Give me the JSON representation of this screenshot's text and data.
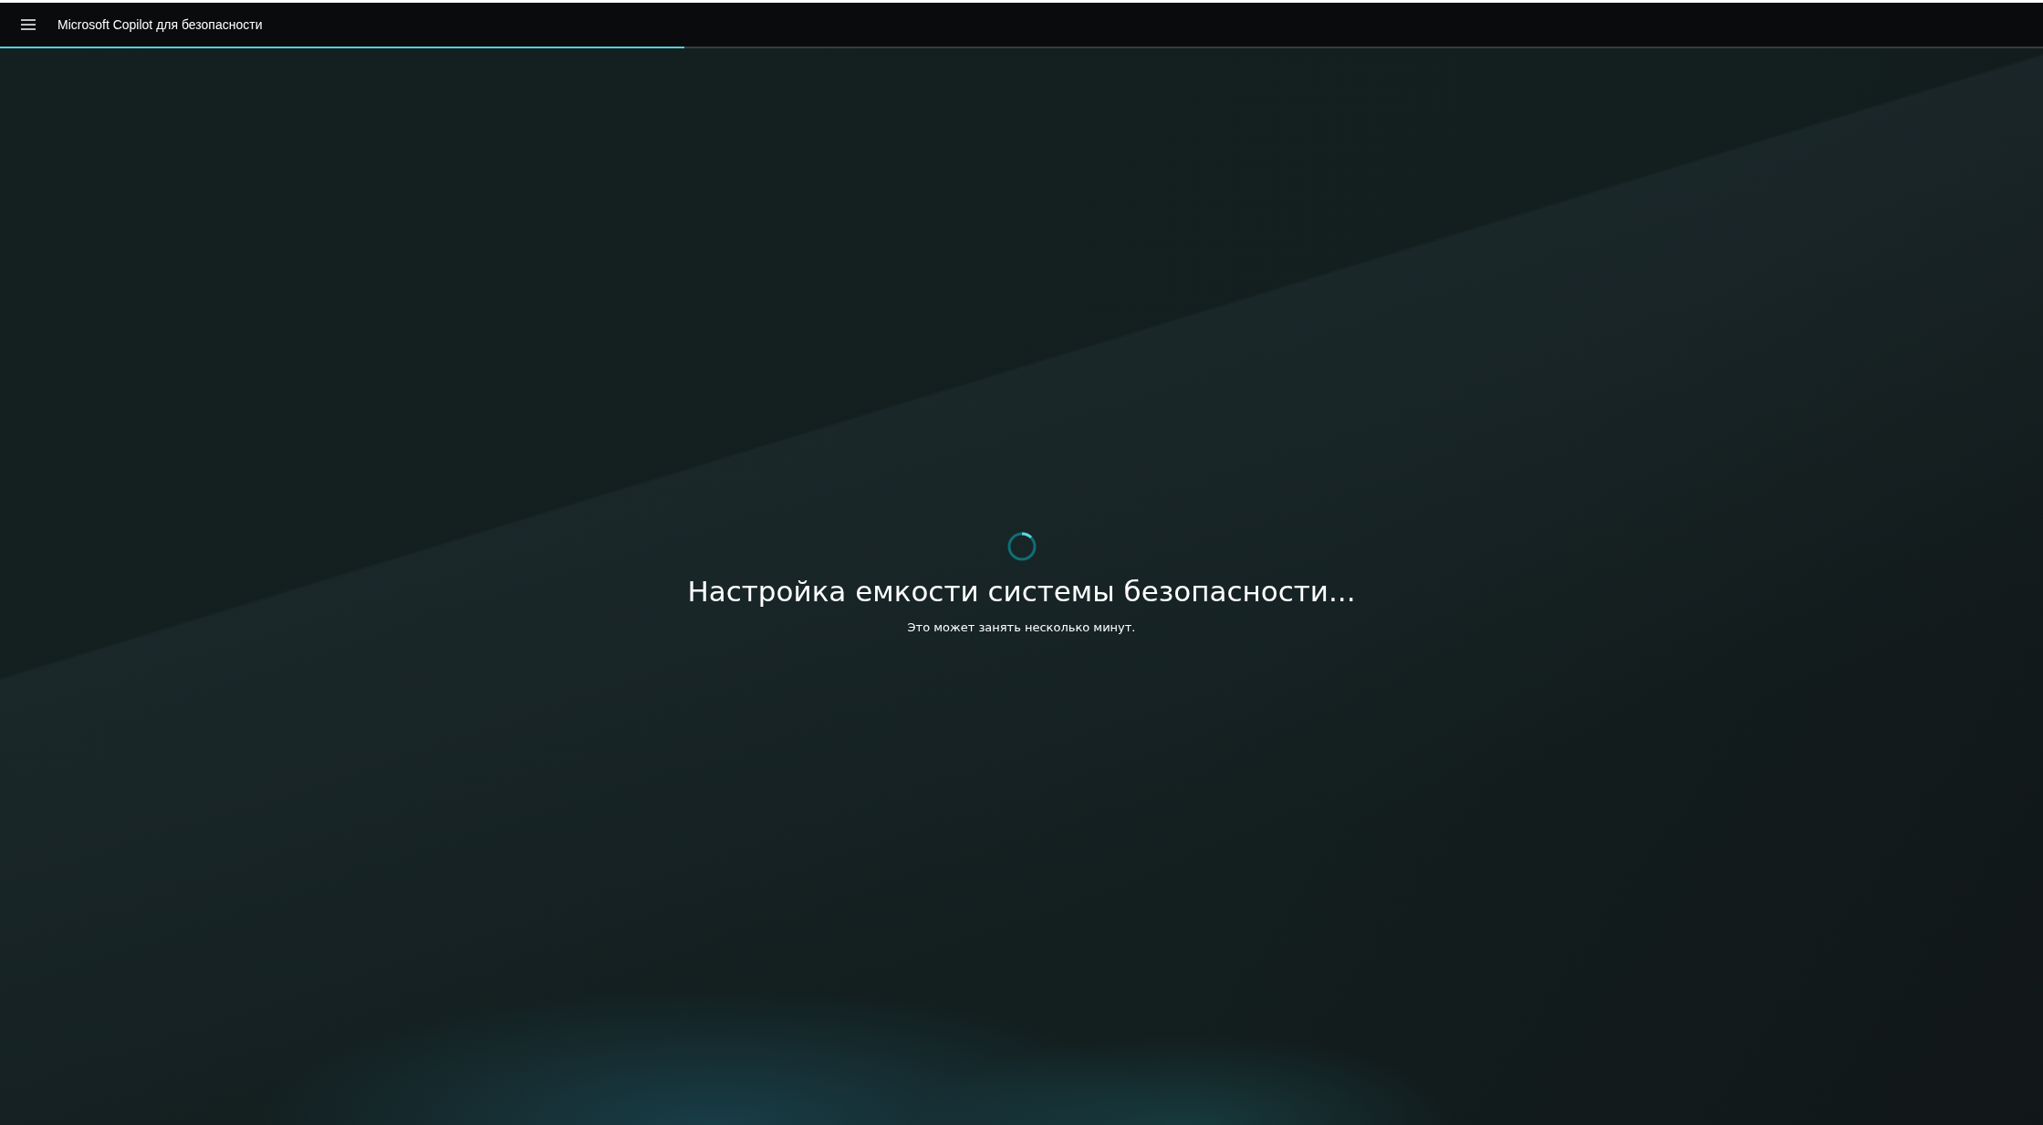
{
  "header": {
    "title": "Microsoft Copilot для безопасности"
  },
  "progress": {
    "level": 0.335
  },
  "status": {
    "heading": "Настройка емкости системы безопасности...",
    "message": "Это может занять несколько минут."
  }
}
